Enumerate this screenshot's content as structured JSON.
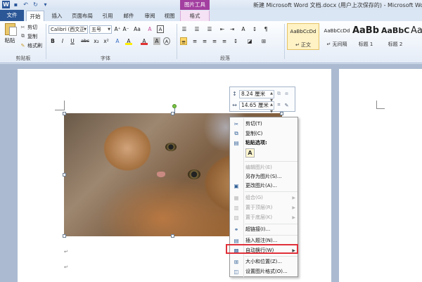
{
  "window": {
    "title": "新建 Microsoft Word 文档.docx (用户上次保存的) - Microsoft Word",
    "contextual_header": "图片工具"
  },
  "quick_access": [
    {
      "name": "word-logo-icon",
      "glyph": "W"
    },
    {
      "name": "save-icon",
      "glyph": "▪"
    },
    {
      "name": "undo-icon",
      "glyph": "↶"
    },
    {
      "name": "repeat-icon",
      "glyph": "↻"
    },
    {
      "name": "customize-icon",
      "glyph": "▾"
    }
  ],
  "tabs": {
    "file": "文件",
    "home": "开始",
    "insert": "插入",
    "layout": "页面布局",
    "references": "引用",
    "mailings": "邮件",
    "review": "审阅",
    "view": "视图",
    "format": "格式"
  },
  "ribbon": {
    "clipboard": {
      "paste": "粘贴",
      "cut": "剪切",
      "copy": "复制",
      "format_painter": "格式刷",
      "label": "剪贴板"
    },
    "font": {
      "family": "Calibri (西文正",
      "size": "五号",
      "label": "字体",
      "buttons": [
        "B",
        "I",
        "U",
        "abc",
        "x₂",
        "x²",
        "A",
        "A",
        "A",
        "A",
        "A"
      ]
    },
    "paragraph": {
      "label": "段落"
    },
    "styles": [
      {
        "preview": "AaBbCcDd",
        "name": "↵ 正文"
      },
      {
        "preview": "AaBbCcDd",
        "name": "↵ 无间隔"
      },
      {
        "preview": "AaBb",
        "name": "标题 1"
      },
      {
        "preview": "AaBbC",
        "name": "标题 2"
      },
      {
        "preview": "AaB",
        "name": ""
      }
    ]
  },
  "size_toolbar": {
    "height": "8.24 厘米",
    "width": "14.65 厘米"
  },
  "context_menu": {
    "items": [
      {
        "key": "cut",
        "label": "剪切(T)",
        "icon": "✂",
        "icon_name": "scissors-icon",
        "disabled": false
      },
      {
        "key": "copy",
        "label": "复制(C)",
        "icon": "⧉",
        "icon_name": "copy-icon",
        "disabled": false
      },
      {
        "key": "paste_options",
        "label": "粘贴选项:",
        "icon": "▤",
        "icon_name": "clipboard-icon",
        "disabled": false,
        "bold": true
      },
      {
        "key": "edit_picture",
        "label": "编辑图片(E)",
        "icon": "",
        "icon_name": "",
        "disabled": true
      },
      {
        "key": "save_as_picture",
        "label": "另存为图片(S)...",
        "icon": "",
        "icon_name": "",
        "disabled": false
      },
      {
        "key": "change_picture",
        "label": "更改图片(A)...",
        "icon": "▣",
        "icon_name": "change-picture-icon",
        "disabled": false
      },
      {
        "key": "group",
        "label": "组合(G)",
        "icon": "▦",
        "icon_name": "group-icon",
        "disabled": true,
        "submenu": true
      },
      {
        "key": "bring_to_front",
        "label": "置于顶层(R)",
        "icon": "▥",
        "icon_name": "bring-front-icon",
        "disabled": true,
        "submenu": true
      },
      {
        "key": "send_to_back",
        "label": "置于底层(K)",
        "icon": "▧",
        "icon_name": "send-back-icon",
        "disabled": true,
        "submenu": true
      },
      {
        "key": "hyperlink",
        "label": "超链接(I)...",
        "icon": "⚭",
        "icon_name": "hyperlink-icon",
        "disabled": false
      },
      {
        "key": "insert_caption",
        "label": "插入题注(N)...",
        "icon": "▤",
        "icon_name": "caption-icon",
        "disabled": false
      },
      {
        "key": "wrap_text",
        "label": "自动换行(W)",
        "icon": "▩",
        "icon_name": "wrap-text-icon",
        "disabled": false,
        "submenu": true,
        "highlighted": true
      },
      {
        "key": "size_position",
        "label": "大小和位置(Z)...",
        "icon": "⊞",
        "icon_name": "size-position-icon",
        "disabled": false
      },
      {
        "key": "format_picture",
        "label": "设置图片格式(O)...",
        "icon": "◫",
        "icon_name": "format-picture-icon",
        "disabled": false
      }
    ],
    "paste_keep_text": "A"
  },
  "colors": {
    "file_tab": "#2b5797",
    "context_tab": "#a33fa0",
    "highlight_box": "#e0303a"
  }
}
